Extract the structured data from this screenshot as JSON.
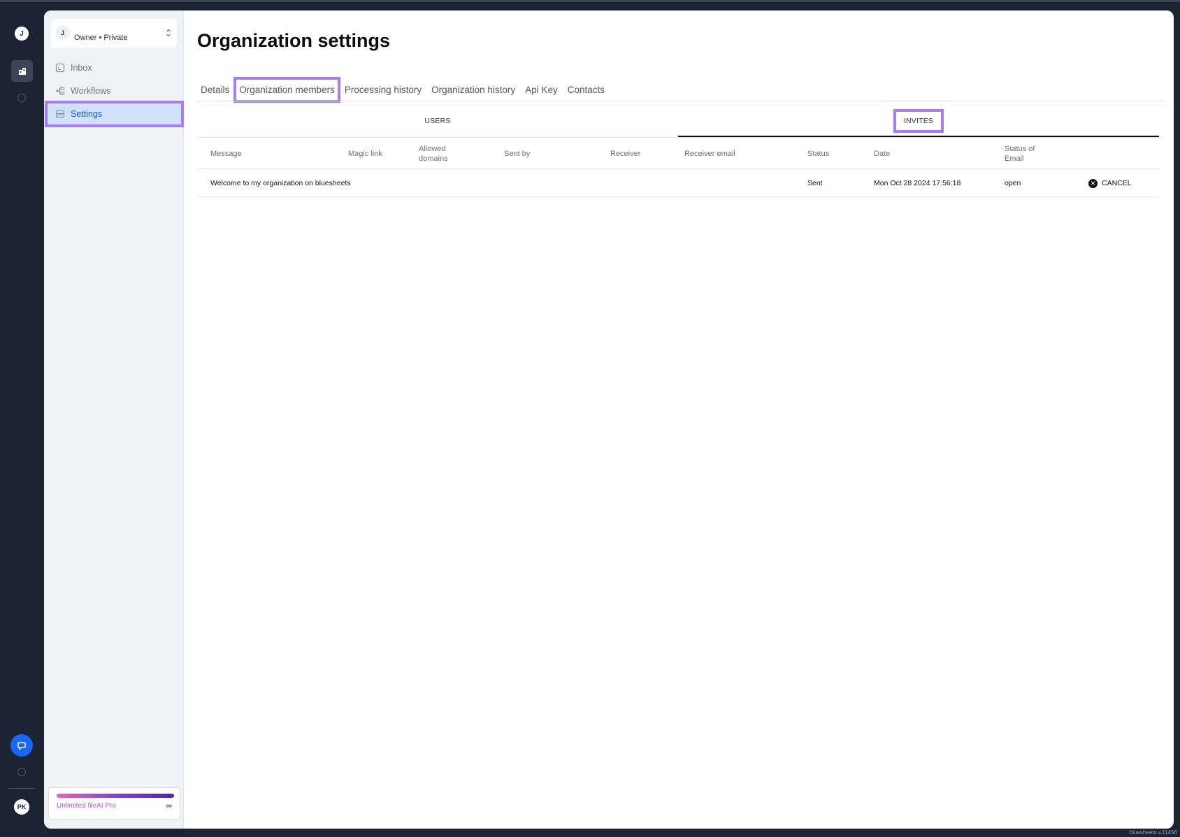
{
  "rail": {
    "user_initial": "J",
    "profile_initials": "PK"
  },
  "org_switcher": {
    "avatar_initial": "J",
    "label": "Owner • Private"
  },
  "sidebar": {
    "items": [
      {
        "label": "Inbox",
        "icon": "inbox-icon",
        "active": false
      },
      {
        "label": "Workflows",
        "icon": "workflow-icon",
        "active": false
      },
      {
        "label": "Settings",
        "icon": "settings-icon",
        "active": true
      }
    ],
    "plan_label": "Unlimited fileAI Pro",
    "plan_symbol": "∞"
  },
  "page": {
    "title": "Organization settings",
    "tabs": [
      {
        "label": "Details"
      },
      {
        "label": "Organization members",
        "highlighted": true
      },
      {
        "label": "Processing history"
      },
      {
        "label": "Organization history"
      },
      {
        "label": "Api Key"
      },
      {
        "label": "Contacts"
      }
    ],
    "subtabs": {
      "users": "USERS",
      "invites": "INVITES",
      "selected": "invites"
    }
  },
  "invites_table": {
    "columns": [
      "Message",
      "Magic link",
      "Allowed domains",
      "Sent by",
      "Receiver",
      "Receiver email",
      "Status",
      "Date",
      "Status of Email"
    ],
    "rows": [
      {
        "message": "Welcome to my organization on bluesheets",
        "magic_link": "",
        "allowed_domains": "",
        "sent_by": "",
        "receiver": "",
        "receiver_email": "",
        "status": "Sent",
        "date": "Mon Oct 28 2024 17:56:18",
        "status_of_email": "open",
        "action": "CANCEL"
      }
    ]
  },
  "footer": {
    "version": "bluesheets v.11456"
  },
  "colors": {
    "rail_bg": "#1c2433",
    "accent_blue": "#1967f5",
    "active_nav_bg": "#cfe1fb",
    "highlight_outline": "#a97cf5"
  }
}
